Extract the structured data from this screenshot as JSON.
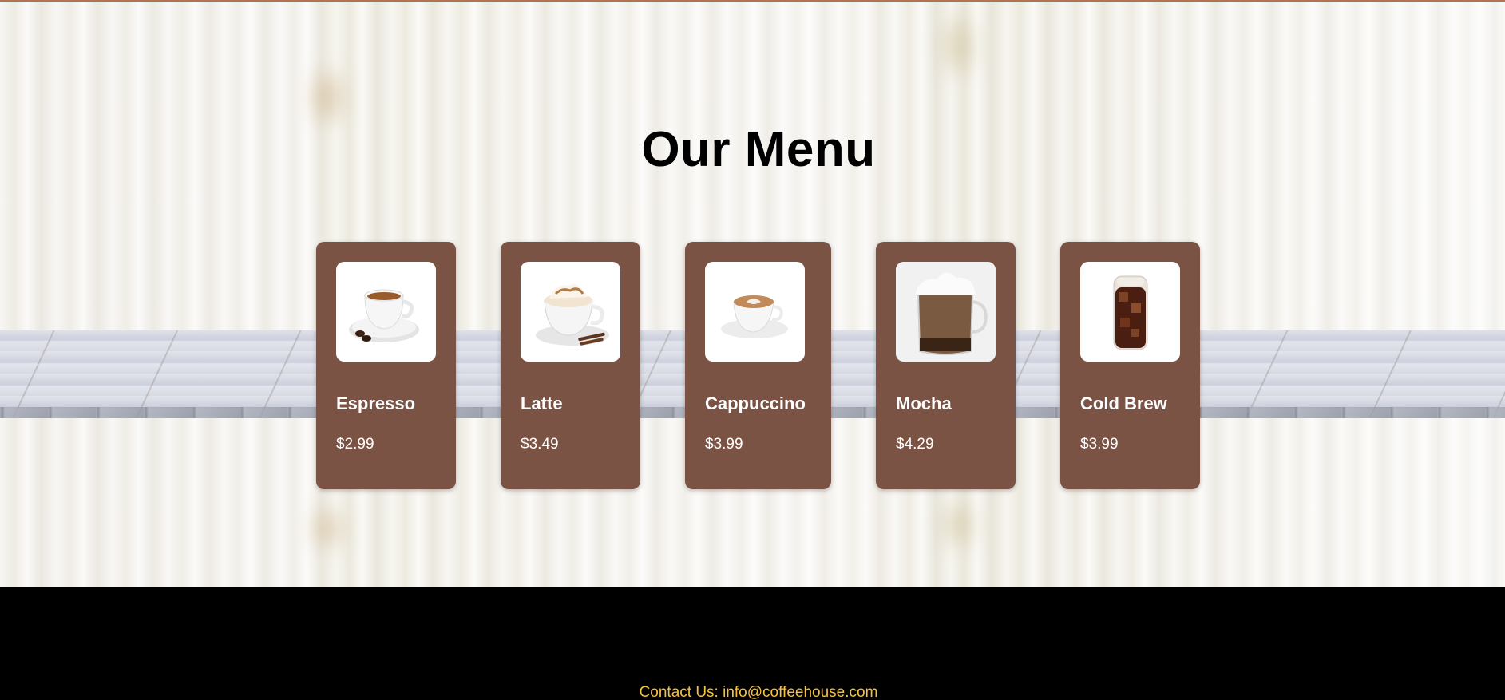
{
  "menu": {
    "title": "Our Menu",
    "items": [
      {
        "name": "Espresso",
        "price": "$2.99",
        "icon": "espresso-cup-icon"
      },
      {
        "name": "Latte",
        "price": "$3.49",
        "icon": "latte-cup-icon"
      },
      {
        "name": "Cappuccino",
        "price": "$3.99",
        "icon": "cappuccino-cup-icon"
      },
      {
        "name": "Mocha",
        "price": "$4.29",
        "icon": "mocha-glass-icon"
      },
      {
        "name": "Cold Brew",
        "price": "$3.99",
        "icon": "cold-brew-glass-icon"
      }
    ]
  },
  "footer": {
    "contact": "Contact Us: info@coffeehouse.com"
  },
  "colors": {
    "card_background": "#7a5344",
    "footer_background": "#000000",
    "contact_text": "#f5c242",
    "title_text": "#000000"
  }
}
